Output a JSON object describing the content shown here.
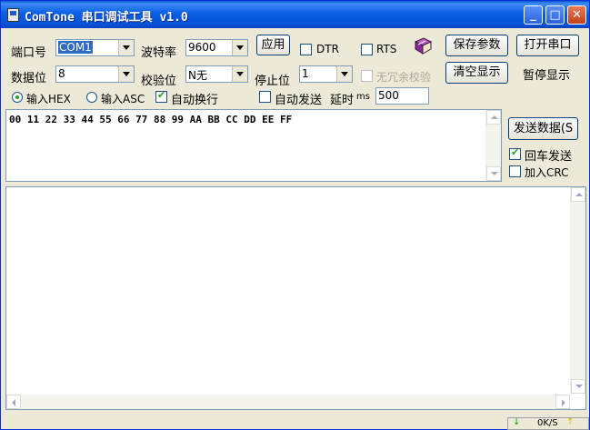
{
  "window": {
    "title": "ComTone 串口调试工具 v1.0",
    "minimize_glyph": "_",
    "maximize_glyph": "□",
    "close_glyph": "✕"
  },
  "settings": {
    "port_label": "端口号",
    "port_value": "COM1",
    "baud_label": "波特率",
    "baud_value": "9600",
    "apply_button": "应用",
    "dtr_label": "DTR",
    "rts_label": "RTS",
    "databits_label": "数据位",
    "databits_value": "8",
    "parity_label": "校验位",
    "parity_value": "N无",
    "stopbits_label": "停止位",
    "stopbits_value": "1",
    "no_redundancy_label": "无冗余校验",
    "save_params_button": "保存参数",
    "open_port_button": "打开串口",
    "clear_display_button": "清空显示",
    "pause_display_label": "暂停显示"
  },
  "options": {
    "input_hex_label": "输入HEX",
    "input_asc_label": "输入ASC",
    "auto_newline_label": "自动换行",
    "auto_send_label": "自动发送",
    "delay_label": "延时",
    "delay_unit": "ms",
    "delay_value": "500"
  },
  "send": {
    "data": "00 11 22 33 44 55 66 77 88 99 AA BB CC DD EE FF",
    "send_button": "发送数据(S",
    "return_send_label": "回车发送",
    "add_crc_label": "加入CRC"
  },
  "status": {
    "rate": "0K/S"
  }
}
